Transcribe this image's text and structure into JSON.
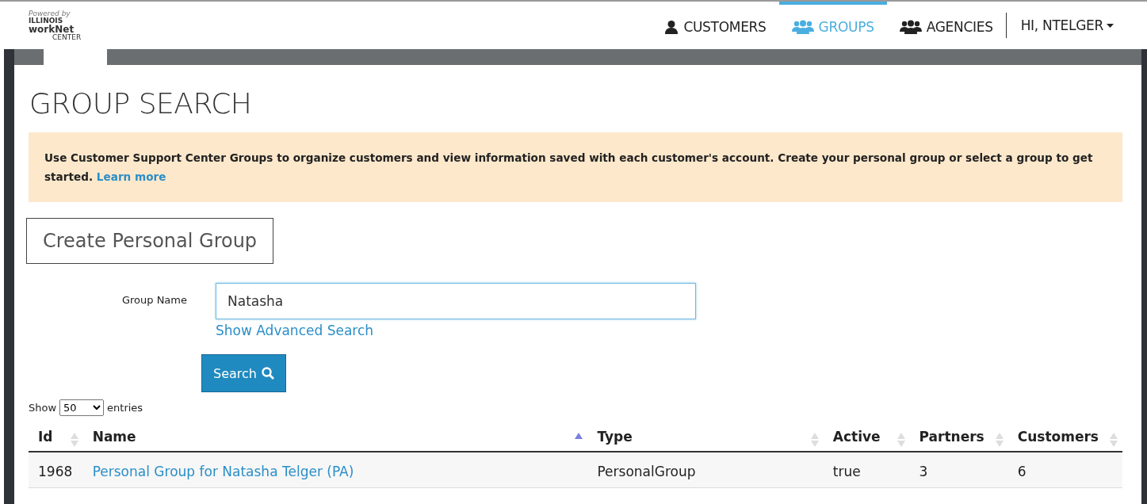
{
  "logo": {
    "powered": "Powered by",
    "state": "ILLINOIS",
    "brand": "workNet",
    "sub": "CENTER"
  },
  "nav": [
    {
      "label": "CUSTOMERS",
      "kind": "person",
      "selected": false
    },
    {
      "label": "GROUPS",
      "kind": "group",
      "selected": true
    },
    {
      "label": "AGENCIES",
      "kind": "group",
      "selected": false
    }
  ],
  "user_menu": "HI, NTELGER",
  "page_title": "GROUP SEARCH",
  "notice": {
    "text": "Use Customer Support Center Groups to organize customers and view information saved with each customer's account. Create your personal group or select a group to get started.",
    "link": "Learn more"
  },
  "create_button": "Create Personal Group",
  "search_form": {
    "label": "Group Name",
    "value": "Natasha",
    "advanced_link": "Show Advanced Search",
    "button": "Search"
  },
  "length_menu": {
    "before": "Show",
    "value": "50",
    "after": "entries"
  },
  "table": {
    "columns": [
      {
        "label": "Id",
        "sorted": false
      },
      {
        "label": "Name",
        "sorted": true
      },
      {
        "label": "Type",
        "sorted": false
      },
      {
        "label": "Active",
        "sorted": false
      },
      {
        "label": "Partners",
        "sorted": false
      },
      {
        "label": "Customers",
        "sorted": false
      }
    ],
    "rows": [
      [
        "1968",
        "Personal Group for Natasha Telger (PA)",
        "PersonalGroup",
        "true",
        "3",
        "6"
      ]
    ]
  }
}
